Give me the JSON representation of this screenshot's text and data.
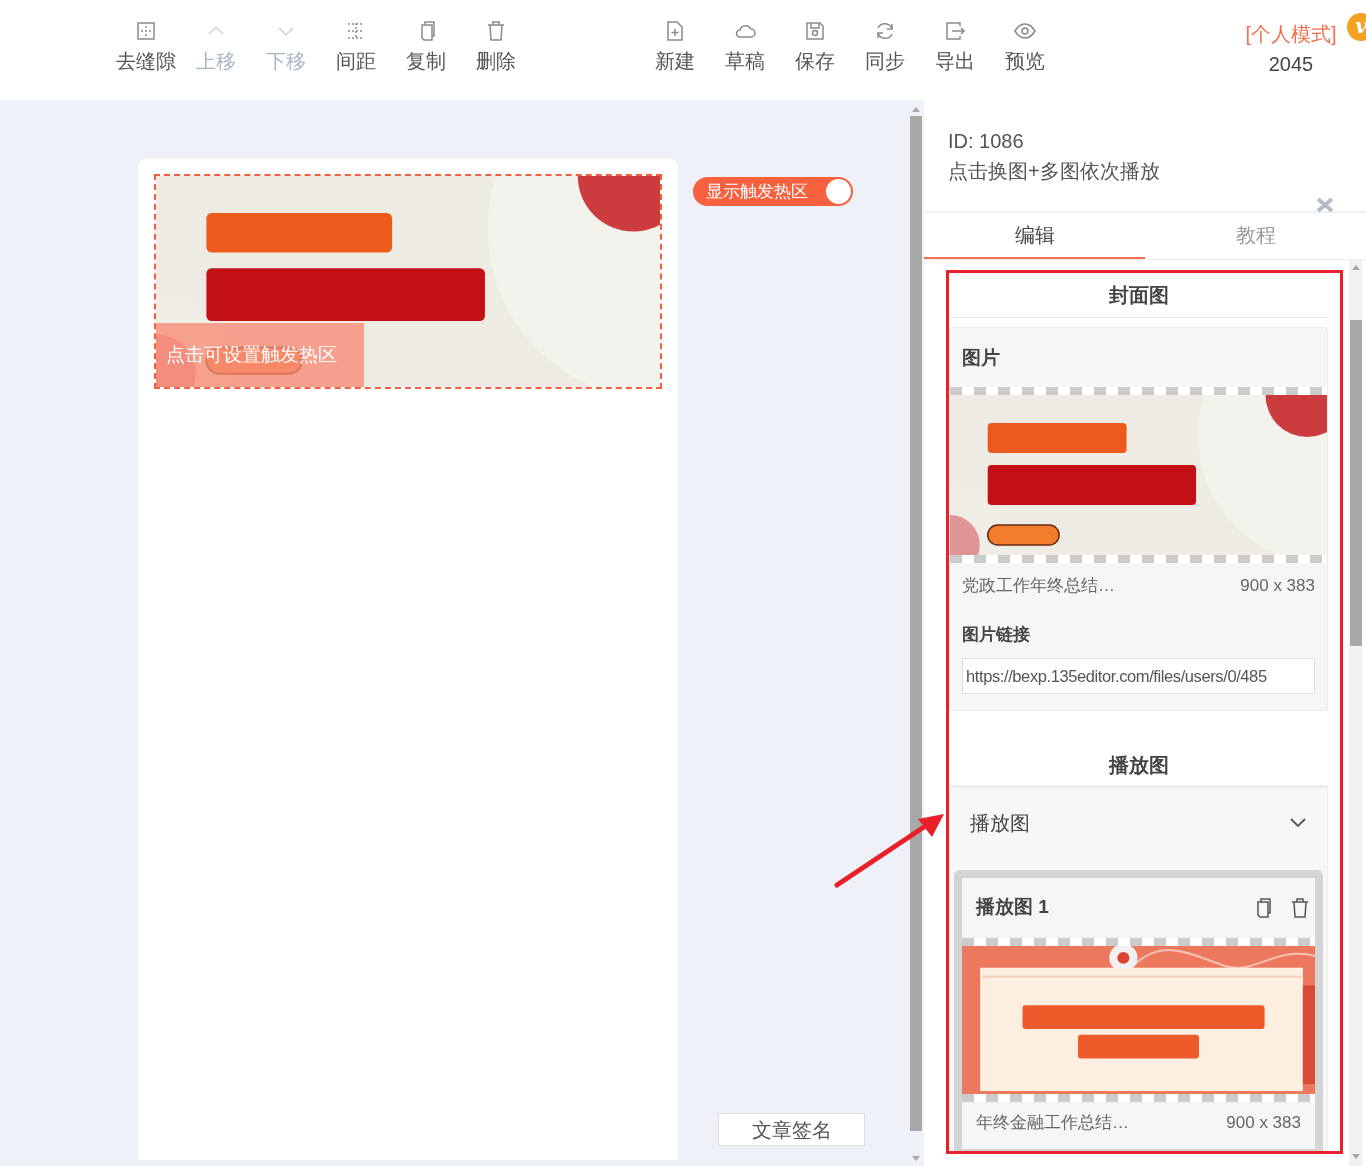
{
  "toolbar": {
    "left_tools": [
      {
        "kind": "gap",
        "label": "去缝隙",
        "disabled": false
      },
      {
        "kind": "up",
        "label": "上移",
        "disabled": true
      },
      {
        "kind": "down",
        "label": "下移",
        "disabled": true
      },
      {
        "kind": "spacing",
        "label": "间距",
        "disabled": false
      },
      {
        "kind": "copy",
        "label": "复制",
        "disabled": false
      },
      {
        "kind": "delete",
        "label": "删除",
        "disabled": false
      }
    ],
    "right_tools": [
      {
        "kind": "new",
        "label": "新建",
        "disabled": false
      },
      {
        "kind": "draft",
        "label": "草稿",
        "disabled": false
      },
      {
        "kind": "save",
        "label": "保存",
        "disabled": false
      },
      {
        "kind": "sync",
        "label": "同步",
        "disabled": false
      },
      {
        "kind": "export",
        "label": "导出",
        "disabled": false
      },
      {
        "kind": "preview",
        "label": "预览",
        "disabled": false
      }
    ],
    "mode": "[个人模式]",
    "badge": "v",
    "count": "2045"
  },
  "canvas": {
    "hotzone_hint": "点击可设置触发热区",
    "signature_button": "文章签名"
  },
  "hotzone_toggle": {
    "label": "显示触发热区",
    "on": true
  },
  "panel": {
    "id": "ID: 1086",
    "description": "点击换图+多图依次播放",
    "tabs": [
      {
        "label": "编辑",
        "selected": true
      },
      {
        "label": "教程",
        "selected": false
      }
    ],
    "cover": {
      "title": "封面图",
      "image_label": "图片",
      "file_name": "党政工作年终总结…",
      "size": "900 x 383",
      "link_label": "图片链接",
      "link_value": "https://bexp.135editor.com/files/users/0/485"
    },
    "slides": {
      "title": "播放图",
      "group_label": "播放图",
      "expanded": true,
      "items": [
        {
          "title": "播放图 1",
          "file_name": "年终金融工作总结…",
          "size": "900 x 383"
        }
      ]
    }
  }
}
